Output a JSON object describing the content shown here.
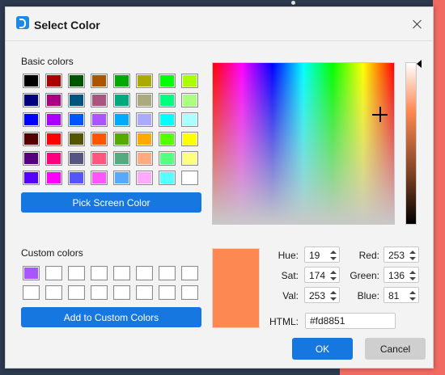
{
  "dialog": {
    "title": "Select Color",
    "app_icon": "app-icon",
    "close_icon": "close-icon"
  },
  "basic": {
    "label": "Basic colors",
    "colors": [
      "#000000",
      "#aa0000",
      "#005500",
      "#aa5500",
      "#00aa00",
      "#aaaa00",
      "#00ff00",
      "#aaff00",
      "#00007f",
      "#aa007f",
      "#00557f",
      "#aa557f",
      "#00aa7f",
      "#aaaa7f",
      "#00ff7f",
      "#aaff7f",
      "#0000ff",
      "#aa00ff",
      "#0055ff",
      "#aa55ff",
      "#00aaff",
      "#aaaaff",
      "#00ffff",
      "#aaffff",
      "#550000",
      "#ff0000",
      "#555500",
      "#ff5500",
      "#55aa00",
      "#ffaa00",
      "#55ff00",
      "#ffff00",
      "#55007f",
      "#ff007f",
      "#55557f",
      "#ff557f",
      "#55aa7f",
      "#ffaa7f",
      "#55ff7f",
      "#ffff7f",
      "#5500ff",
      "#ff00ff",
      "#5555ff",
      "#ff55ff",
      "#55aaff",
      "#ffaaff",
      "#55ffff",
      "#ffffff"
    ],
    "pick_button": "Pick Screen Color"
  },
  "custom": {
    "label": "Custom colors",
    "colors": [
      "#aa55ff",
      "#ffffff",
      "#ffffff",
      "#ffffff",
      "#ffffff",
      "#ffffff",
      "#ffffff",
      "#ffffff",
      "#ffffff",
      "#ffffff",
      "#ffffff",
      "#ffffff",
      "#ffffff",
      "#ffffff",
      "#ffffff",
      "#ffffff"
    ],
    "add_button": "Add to Custom Colors"
  },
  "current_color": "#fd8851",
  "fields": {
    "hue_label": "Hue:",
    "hue": "19",
    "sat_label": "Sat:",
    "sat": "174",
    "val_label": "Val:",
    "val": "253",
    "red_label": "Red:",
    "red": "253",
    "green_label": "Green:",
    "green": "136",
    "blue_label": "Blue:",
    "blue": "81",
    "html_label": "HTML:",
    "html": "#fd8851"
  },
  "buttons": {
    "ok": "OK",
    "cancel": "Cancel"
  },
  "accent": "#1677e0"
}
